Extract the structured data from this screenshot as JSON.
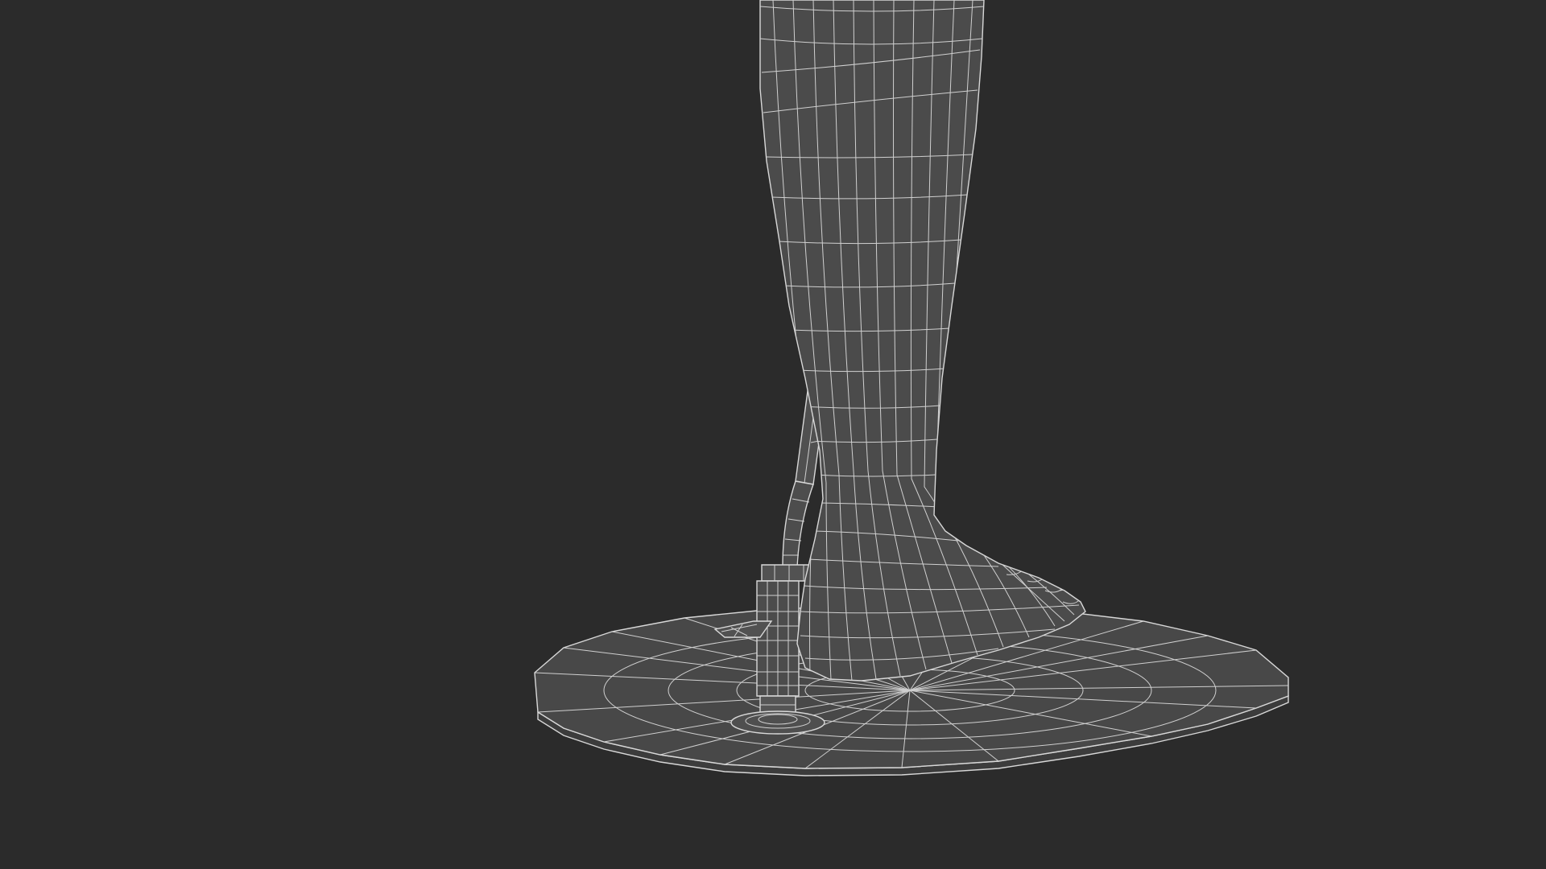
{
  "scene": {
    "background_color": "#2b2b2b",
    "surface_color": "#4a4a4a",
    "wire_color": "#d0d0d0",
    "objects": [
      {
        "name": "base-plate",
        "kind": "circular-display-base"
      },
      {
        "name": "leg",
        "kind": "mannequin-lower-leg"
      },
      {
        "name": "foot",
        "kind": "mannequin-foot"
      },
      {
        "name": "support-rod",
        "kind": "calf-support-rod"
      },
      {
        "name": "support-post",
        "kind": "threaded-support-post"
      },
      {
        "name": "clamp-knob",
        "kind": "wing-screw"
      }
    ]
  }
}
